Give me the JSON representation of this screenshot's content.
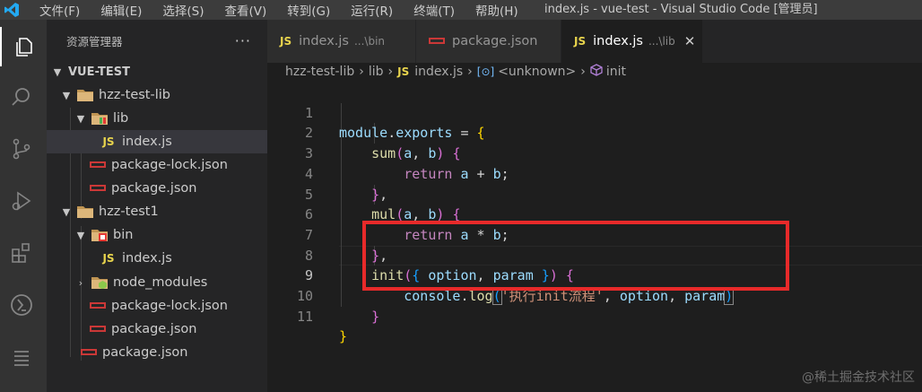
{
  "menu": [
    "文件(F)",
    "编辑(E)",
    "选择(S)",
    "查看(V)",
    "转到(G)",
    "运行(R)",
    "终端(T)",
    "帮助(H)"
  ],
  "window_title": "index.js - vue-test - Visual Studio Code [管理员]",
  "sidebar": {
    "title": "资源管理器",
    "more": "···",
    "root": "VUE-TEST",
    "items": [
      {
        "label": "hzz-test-lib"
      },
      {
        "label": "lib"
      },
      {
        "label": "index.js"
      },
      {
        "label": "package-lock.json"
      },
      {
        "label": "package.json"
      },
      {
        "label": "hzz-test1"
      },
      {
        "label": "bin"
      },
      {
        "label": "index.js"
      },
      {
        "label": "node_modules"
      },
      {
        "label": "package-lock.json"
      },
      {
        "label": "package.json"
      },
      {
        "label": "package.json"
      }
    ]
  },
  "tabs": [
    {
      "label": "index.js",
      "desc": "...\\bin",
      "icon": "JS"
    },
    {
      "label": "package.json",
      "desc": "",
      "icon": "npm"
    },
    {
      "label": "index.js",
      "desc": "...\\lib",
      "icon": "JS",
      "close": "✕"
    }
  ],
  "breadcrumb": {
    "parts": [
      "hzz-test-lib",
      "lib",
      "index.js",
      "<unknown>",
      "init"
    ],
    "sep": "›",
    "unknown_icon": "[⊙]"
  },
  "editor": {
    "line_numbers": [
      "1",
      "2",
      "3",
      "4",
      "5",
      "6",
      "7",
      "8",
      "9",
      "10",
      "11"
    ],
    "current_line": 9
  },
  "watermark": "@稀土掘金技术社区",
  "colors": {
    "highlight_box": "#e82a2a",
    "accent": "#007acc"
  }
}
